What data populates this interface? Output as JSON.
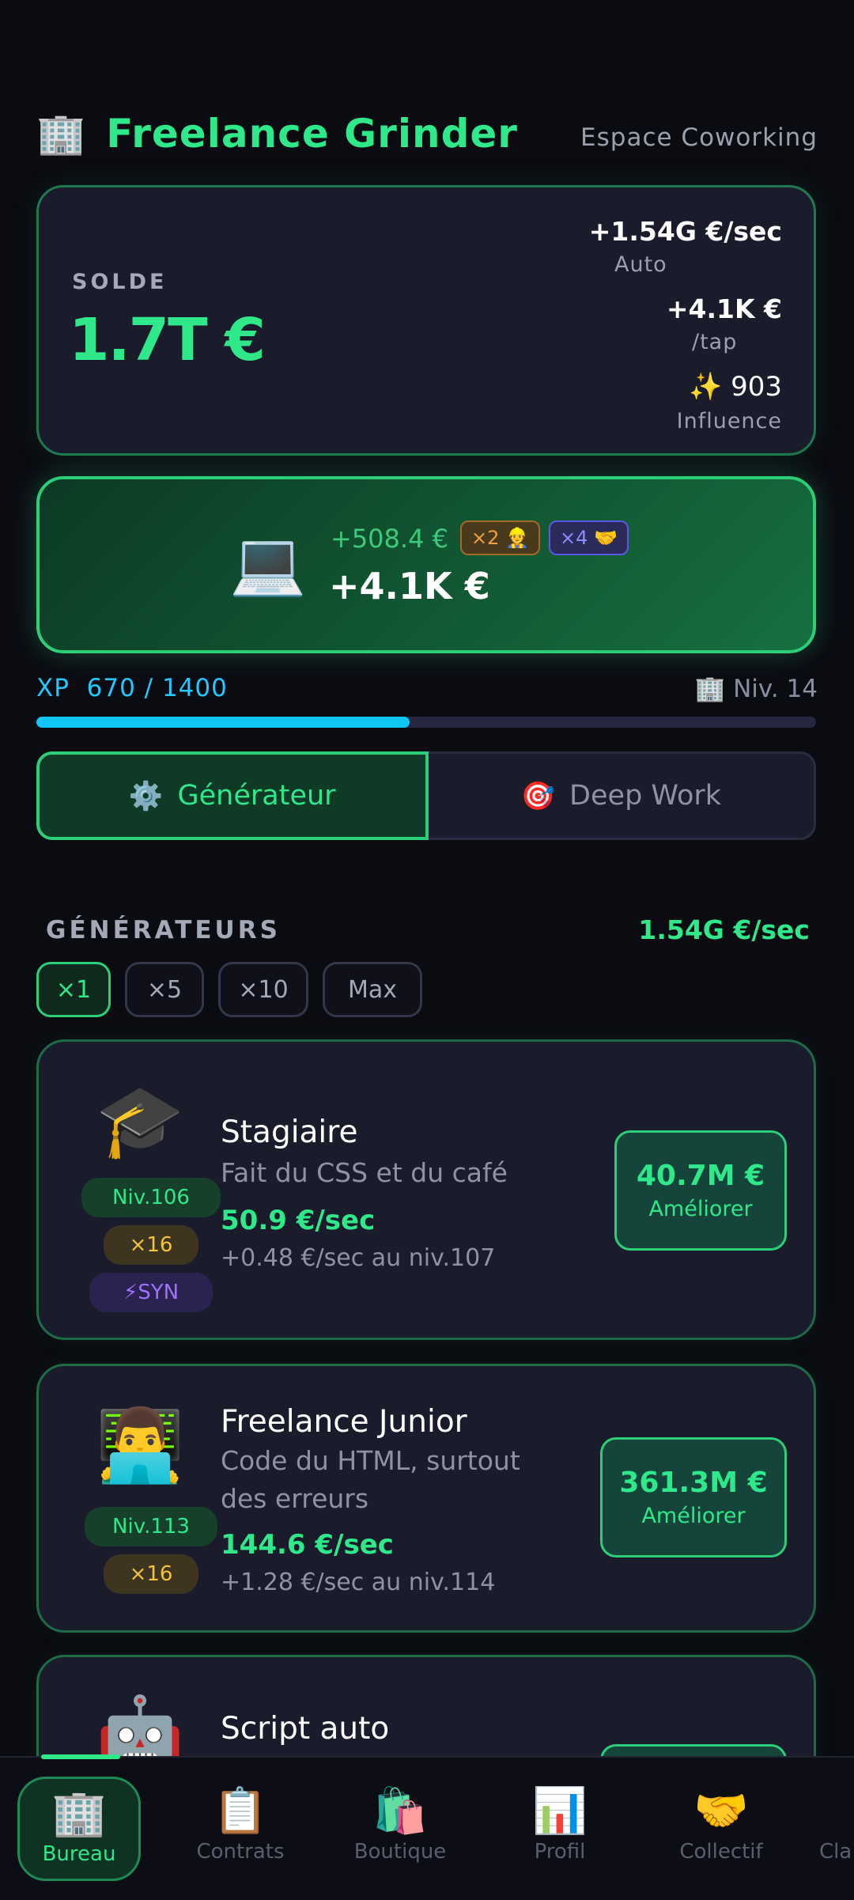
{
  "header": {
    "app_icon": "🏢",
    "app_title": "Freelance Grinder",
    "location": "Espace Coworking"
  },
  "balance": {
    "label": "SOLDE",
    "value": "1.7T €",
    "auto_value": "+1.54G €/sec",
    "auto_label": "Auto",
    "tap_value": "+4.1K €",
    "tap_label": "/tap",
    "influence_value": "✨ 903",
    "influence_label": "Influence"
  },
  "tap_area": {
    "icon": "💻",
    "sub_value": "+508.4 €",
    "badge_1": "×2 👷",
    "badge_2": "×4 🤝",
    "main_value": "+4.1K €"
  },
  "xp": {
    "label": "XP  670 / 1400",
    "current": 670,
    "max": 1400,
    "level_label": "🏢 Niv. 14"
  },
  "modes": {
    "generator_icon": "⚙️",
    "generator_label": "Générateur",
    "deepwork_icon": "🎯",
    "deepwork_label": "Deep Work"
  },
  "generators": {
    "title": "GÉNÉRATEURS",
    "total_rate": "1.54G €/sec",
    "multipliers": [
      "×1",
      "×5",
      "×10",
      "Max"
    ],
    "active_multiplier": "×1",
    "items": [
      {
        "icon": "🎓",
        "name": "Stagiaire",
        "desc": "Fait du CSS et du café",
        "prod": "50.9 €/sec",
        "next": "+0.48 €/sec au niv.107",
        "level": "Niv.106",
        "mult": "×16",
        "syn": "⚡SYN",
        "price": "40.7M €",
        "action": "Améliorer"
      },
      {
        "icon": "👨‍💻",
        "name": "Freelance Junior",
        "desc_line1": "Code du HTML, surtout",
        "desc_line2": "des erreurs",
        "prod": "144.6 €/sec",
        "next": "+1.28 €/sec au niv.114",
        "level": "Niv.113",
        "mult": "×16",
        "price": "361.3M €",
        "action": "Améliorer"
      },
      {
        "icon": "🤖",
        "name": "Script auto"
      }
    ]
  },
  "nav": {
    "items": [
      {
        "icon": "🏢",
        "label": "Bureau"
      },
      {
        "icon": "📋",
        "label": "Contrats"
      },
      {
        "icon": "🛍️",
        "label": "Boutique"
      },
      {
        "icon": "📊",
        "label": "Profil"
      },
      {
        "icon": "🤝",
        "label": "Collectif"
      },
      {
        "label": "Cla"
      }
    ]
  },
  "colors": {
    "accent": "#2ee88a",
    "xp": "#10c6f5",
    "background": "#0b0b12",
    "card": "#1a1b2b"
  }
}
